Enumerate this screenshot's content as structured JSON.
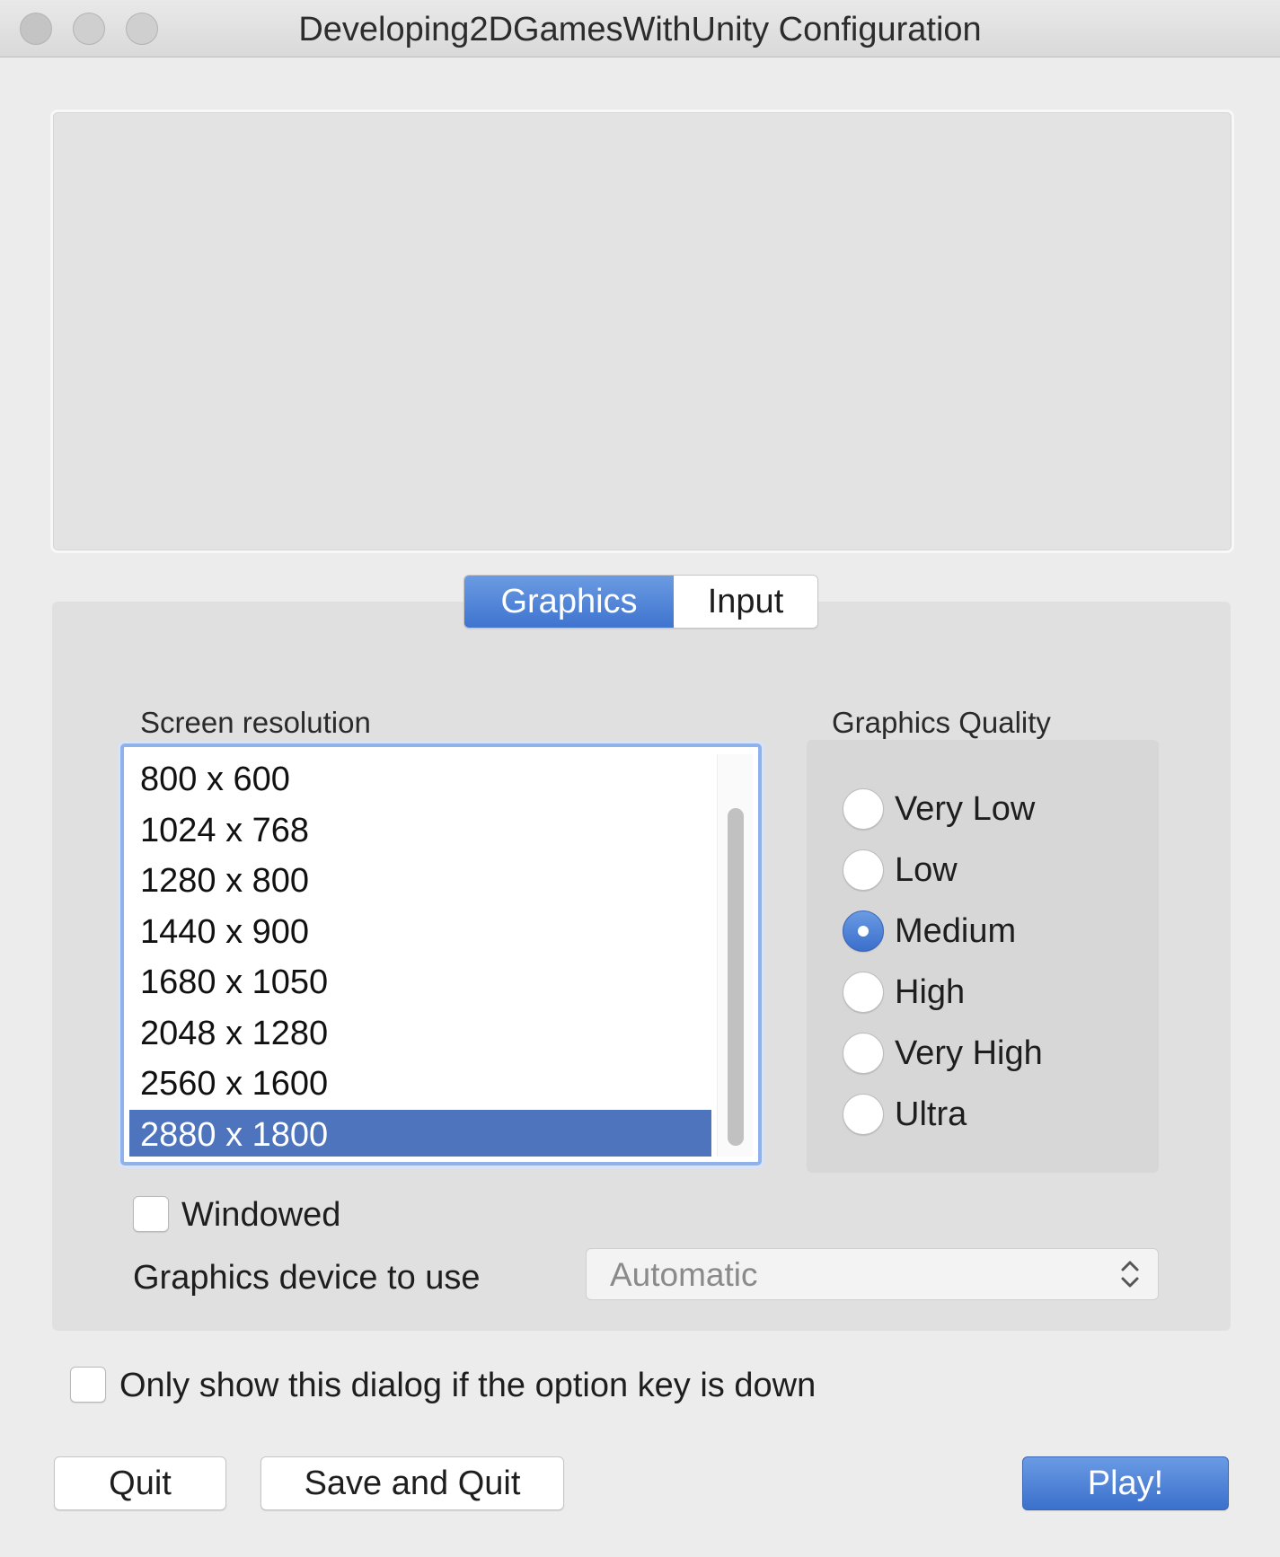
{
  "window": {
    "title": "Developing2DGamesWithUnity Configuration"
  },
  "tabs": [
    {
      "label": "Graphics",
      "active": true
    },
    {
      "label": "Input",
      "active": false
    }
  ],
  "graphics": {
    "resolution_label": "Screen resolution",
    "resolutions": [
      "800 x 600",
      "1024 x 768",
      "1280 x 800",
      "1440 x 900",
      "1680 x 1050",
      "2048 x 1280",
      "2560 x 1600",
      "2880 x 1800"
    ],
    "selected_resolution": "2880 x 1800",
    "quality_label": "Graphics Quality",
    "quality_options": [
      "Very Low",
      "Low",
      "Medium",
      "High",
      "Very High",
      "Ultra"
    ],
    "selected_quality": "Medium",
    "windowed_label": "Windowed",
    "windowed_checked": false,
    "device_label": "Graphics device to use",
    "device_value": "Automatic"
  },
  "option_key_label": "Only show this dialog if the option key is down",
  "option_key_checked": false,
  "buttons": {
    "quit": "Quit",
    "save_and_quit": "Save and Quit",
    "play": "Play!"
  },
  "colors": {
    "accent": "#4d74bd",
    "window_bg": "#ececec"
  }
}
